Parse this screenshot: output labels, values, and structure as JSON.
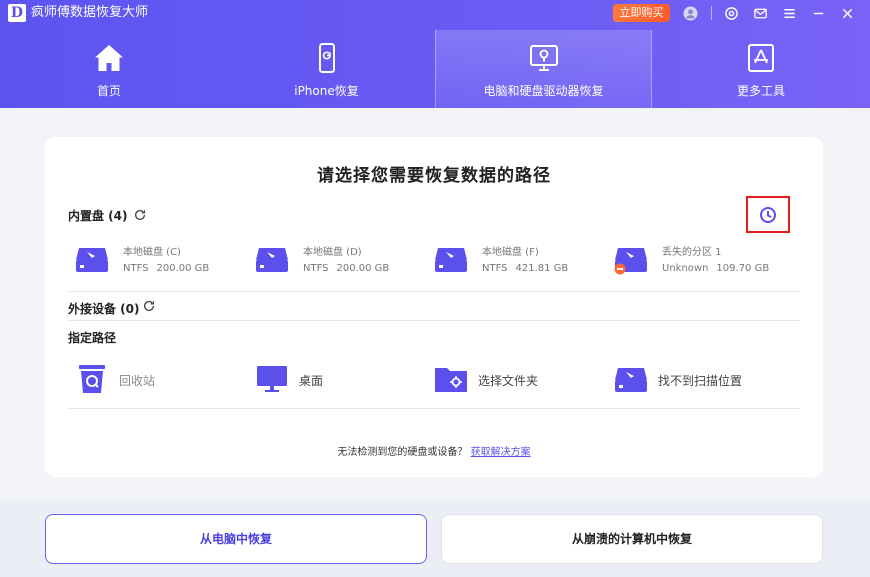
{
  "app": {
    "logo_letter": "D",
    "title": "疯师傅数据恢复大师",
    "buy_label": "立即购买"
  },
  "nav": {
    "items": [
      {
        "label": "首页",
        "icon": "home-icon"
      },
      {
        "label": "iPhone恢复",
        "icon": "phone-icon"
      },
      {
        "label": "电脑和硬盘驱动器恢复",
        "icon": "computer-drive-icon",
        "active": true
      },
      {
        "label": "更多工具",
        "icon": "tools-icon"
      }
    ]
  },
  "main": {
    "title": "请选择您需要恢复数据的路径",
    "internal": {
      "label": "内置盘 (4)",
      "disks": [
        {
          "name": "本地磁盘 (C)",
          "fs": "NTFS",
          "size": "200.00 GB"
        },
        {
          "name": "本地磁盘 (D)",
          "fs": "NTFS",
          "size": "200.00 GB"
        },
        {
          "name": "本地磁盘 (F)",
          "fs": "NTFS",
          "size": "421.81 GB"
        },
        {
          "name": "丢失的分区 1",
          "fs": "Unknown",
          "size": "109.70 GB"
        }
      ]
    },
    "external": {
      "label": "外接设备 (0)"
    },
    "paths": {
      "label": "指定路径",
      "items": [
        {
          "label": "回收站",
          "icon": "recycle-bin-icon"
        },
        {
          "label": "桌面",
          "icon": "desktop-icon"
        },
        {
          "label": "选择文件夹",
          "icon": "folder-icon"
        },
        {
          "label": "找不到扫描位置",
          "icon": "scan-location-icon"
        }
      ]
    },
    "hint_text": "无法检测到您的硬盘或设备？",
    "hint_link": "获取解决方案"
  },
  "bottom": {
    "primary_label": "从电脑中恢复",
    "secondary_label": "从崩溃的计算机中恢复"
  },
  "colors": {
    "accent": "#5b50ec",
    "header_start": "#5d54f0",
    "buy_button": "#ff6a30",
    "highlight_border": "#e02020"
  }
}
